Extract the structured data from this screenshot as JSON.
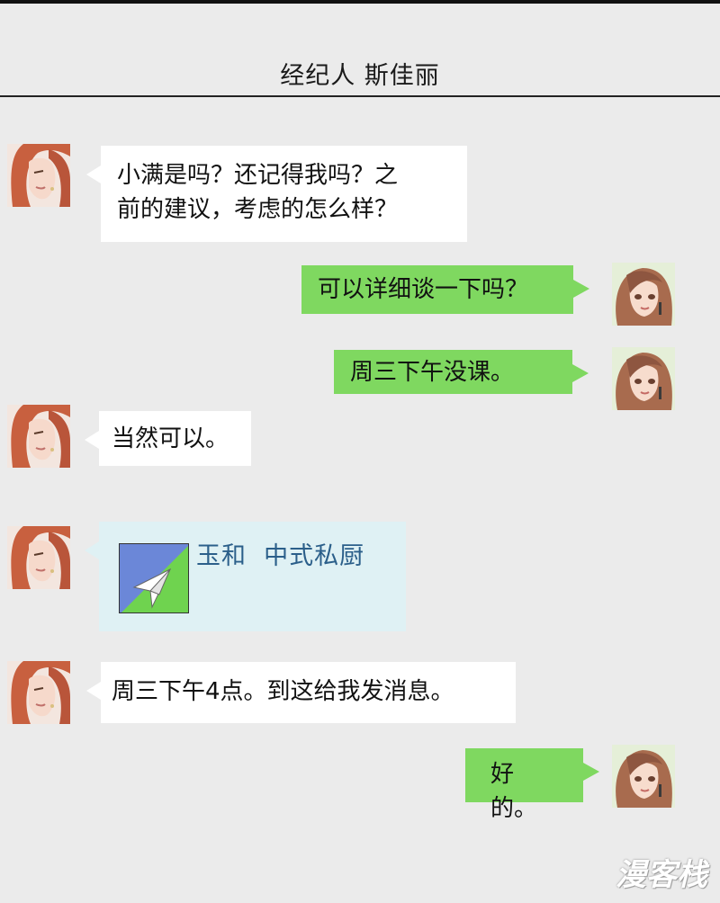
{
  "header": {
    "title": "经纪人  斯佳丽"
  },
  "messages": [
    {
      "from": "agent",
      "text_lines": [
        "小满是吗？还记得我吗？之",
        "前的建议，考虑的怎么样？"
      ]
    },
    {
      "from": "me",
      "text": "可以详细谈一下吗？"
    },
    {
      "from": "me",
      "text": "周三下午没课。"
    },
    {
      "from": "agent",
      "text": "当然可以。"
    },
    {
      "from": "agent",
      "type": "location-card",
      "title": "玉和  中式私厨",
      "icon": "paper-plane-icon"
    },
    {
      "from": "agent",
      "text": "周三下午4点。到这给我发消息。"
    },
    {
      "from": "me",
      "text": "好的。"
    }
  ],
  "watermark": "漫客栈",
  "colors": {
    "background": "#ebebeb",
    "my_bubble": "#7fd860",
    "their_bubble": "#ffffff",
    "card": "#dff1f4",
    "card_title": "#2b5f8a"
  }
}
